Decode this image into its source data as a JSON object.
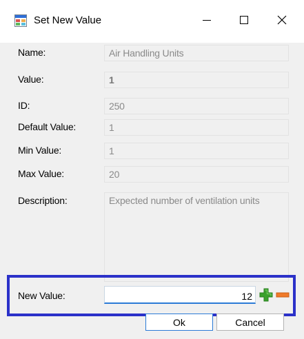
{
  "window": {
    "title": "Set New Value",
    "icons": {
      "app": "app-window-icon",
      "minimize": "minimize-icon",
      "maximize": "maximize-icon",
      "close": "close-icon"
    }
  },
  "fields": {
    "name": {
      "label": "Name:",
      "value": "Air Handling Units"
    },
    "value": {
      "label": "Value:",
      "value": "1"
    },
    "id": {
      "label": "ID:",
      "value": "250"
    },
    "default_value": {
      "label": "Default Value:",
      "value": "1"
    },
    "min_value": {
      "label": "Min Value:",
      "value": "1"
    },
    "max_value": {
      "label": "Max Value:",
      "value": "20"
    },
    "description": {
      "label": "Description:",
      "value": "Expected number of ventilation units"
    }
  },
  "new_value": {
    "label": "New Value:",
    "value": "12",
    "increment_icon": "plus-icon",
    "decrement_icon": "minus-icon"
  },
  "buttons": {
    "ok": "Ok",
    "cancel": "Cancel"
  },
  "colors": {
    "highlight": "#2b31c9",
    "plus": "#3aa02c",
    "minus": "#f07a2a"
  }
}
